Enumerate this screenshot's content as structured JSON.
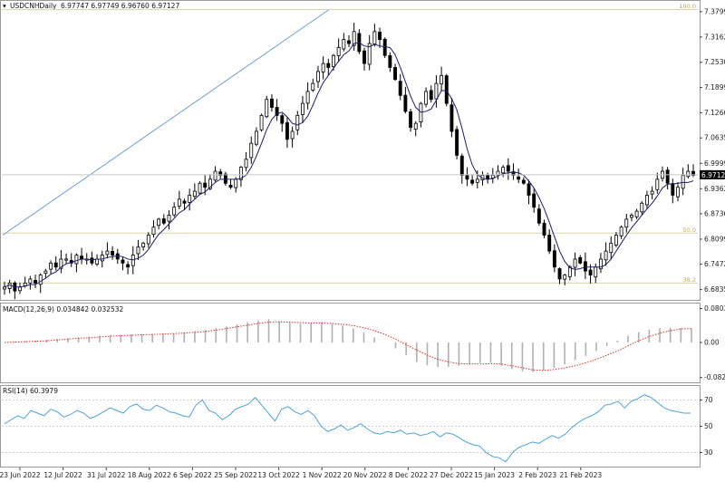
{
  "main_header": {
    "symbol_label": "USDCNHDaily",
    "ohlc_values": "6.97747 6.97749 6.96760 6.97127"
  },
  "macd_header": "MACD(12,26,9) 0.034842 0.032532",
  "rsi_header": "RSI(14) 60.3979",
  "colors": {
    "candle": "#000000",
    "ma_line": "#1c1c6e",
    "trendline": "#6f9fd8",
    "fib_line": "#d8d2a6",
    "macd_hist": "#b0b0b0",
    "macd_signal": "#e0302a",
    "rsi_line": "#4aa3df",
    "current_price_bg": "#000000"
  },
  "chart_data": [
    {
      "type": "candlestick",
      "pane": "price",
      "ylim": [
        6.66,
        7.4
      ],
      "yticks": [
        6.68355,
        6.7472,
        6.8099,
        6.87365,
        6.93625,
        6.9999,
        7.06355,
        7.12665,
        7.1899,
        7.25305,
        7.31625,
        7.3799
      ],
      "ytick_labels": [
        "6.68355",
        "6.74720",
        "6.80990",
        "6.87365",
        "6.93625",
        "6.99990",
        "7.06355",
        "7.12665",
        "7.18990",
        "7.25305",
        "7.31625",
        "7.37990"
      ],
      "current_price": 6.97127,
      "current_price_label": "6.97127",
      "fib_levels": [
        {
          "label": "100.0",
          "value": 7.385
        },
        {
          "label": "50.0",
          "value": 6.825
        },
        {
          "label": "38.2",
          "value": 6.7
        }
      ],
      "trendline": {
        "from": [
          "2022-06-23",
          6.82
        ],
        "to": [
          "2022-10-24",
          7.385
        ]
      },
      "x_labels": [
        "23 Jun 2022",
        "12 Jul 2022",
        "31 Jul 2022",
        "18 Aug 2022",
        "6 Sep 2022",
        "25 Sep 2022",
        "13 Oct 2022",
        "1 Nov 2022",
        "20 Nov 2022",
        "8 Dec 2022",
        "27 Dec 2022",
        "15 Jan 2023",
        "2 Feb 2023",
        "21 Feb 2023"
      ],
      "close_series": [
        6.69,
        6.7,
        6.68,
        6.69,
        6.7,
        6.71,
        6.7,
        6.72,
        6.73,
        6.75,
        6.74,
        6.76,
        6.76,
        6.75,
        6.77,
        6.76,
        6.76,
        6.75,
        6.76,
        6.77,
        6.78,
        6.77,
        6.76,
        6.75,
        6.74,
        6.77,
        6.79,
        6.8,
        6.82,
        6.84,
        6.86,
        6.85,
        6.87,
        6.89,
        6.91,
        6.9,
        6.92,
        6.93,
        6.95,
        6.94,
        6.96,
        6.98,
        6.97,
        6.95,
        6.94,
        6.96,
        6.99,
        7.01,
        7.05,
        7.08,
        7.12,
        7.16,
        7.14,
        7.12,
        7.1,
        7.06,
        7.08,
        7.12,
        7.15,
        7.18,
        7.2,
        7.23,
        7.25,
        7.24,
        7.27,
        7.29,
        7.31,
        7.3,
        7.33,
        7.28,
        7.25,
        7.3,
        7.33,
        7.31,
        7.27,
        7.24,
        7.21,
        7.17,
        7.13,
        7.09,
        7.1,
        7.15,
        7.18,
        7.16,
        7.2,
        7.22,
        7.15,
        7.08,
        7.02,
        6.97,
        6.96,
        6.95,
        6.96,
        6.97,
        6.96,
        6.97,
        6.98,
        6.99,
        6.98,
        6.97,
        6.96,
        6.95,
        6.92,
        6.89,
        6.85,
        6.82,
        6.78,
        6.74,
        6.71,
        6.72,
        6.74,
        6.76,
        6.75,
        6.73,
        6.72,
        6.74,
        6.76,
        6.78,
        6.8,
        6.82,
        6.84,
        6.86,
        6.87,
        6.88,
        6.9,
        6.92,
        6.93,
        6.96,
        6.98,
        6.95,
        6.92,
        6.94,
        6.97,
        6.98,
        6.97
      ]
    },
    {
      "type": "bar+line",
      "pane": "macd",
      "ylim": [
        -0.09,
        0.09
      ],
      "yticks": [
        0.080366,
        0,
        -0.08289
      ],
      "ytick_labels": [
        "0.080366",
        "0.00",
        "-0.08289"
      ],
      "series": [
        {
          "name": "MACD",
          "role": "histogram",
          "values": [
            0.0,
            0.002,
            0.003,
            0.004,
            0.006,
            0.008,
            0.01,
            0.012,
            0.014,
            0.016,
            0.017,
            0.018,
            0.019,
            0.02,
            0.02,
            0.021,
            0.022,
            0.024,
            0.027,
            0.03,
            0.034,
            0.038,
            0.043,
            0.048,
            0.052,
            0.055,
            0.05,
            0.046,
            0.044,
            0.045,
            0.046,
            0.044,
            0.04,
            0.033,
            0.024,
            0.012,
            0.0,
            -0.014,
            -0.03,
            -0.046,
            -0.054,
            -0.058,
            -0.058,
            -0.055,
            -0.052,
            -0.048,
            -0.048,
            -0.055,
            -0.063,
            -0.068,
            -0.07,
            -0.066,
            -0.06,
            -0.052,
            -0.042,
            -0.032,
            -0.02,
            -0.008,
            0.004,
            0.016,
            0.024,
            0.03,
            0.034,
            0.035,
            0.034,
            0.033
          ]
        },
        {
          "name": "Signal",
          "role": "line",
          "values": [
            0.0,
            0.001,
            0.002,
            0.003,
            0.004,
            0.006,
            0.008,
            0.01,
            0.011,
            0.013,
            0.015,
            0.016,
            0.017,
            0.018,
            0.019,
            0.02,
            0.021,
            0.022,
            0.024,
            0.026,
            0.029,
            0.033,
            0.037,
            0.041,
            0.045,
            0.048,
            0.049,
            0.048,
            0.047,
            0.046,
            0.046,
            0.045,
            0.043,
            0.04,
            0.035,
            0.028,
            0.019,
            0.008,
            -0.005,
            -0.018,
            -0.03,
            -0.04,
            -0.046,
            -0.05,
            -0.051,
            -0.051,
            -0.05,
            -0.051,
            -0.055,
            -0.06,
            -0.065,
            -0.066,
            -0.064,
            -0.06,
            -0.055,
            -0.048,
            -0.04,
            -0.03,
            -0.02,
            -0.008,
            0.004,
            0.014,
            0.022,
            0.028,
            0.032,
            0.033
          ]
        }
      ]
    },
    {
      "type": "line",
      "pane": "rsi",
      "ylim": [
        20,
        80
      ],
      "yticks": [
        70,
        50,
        30
      ],
      "ytick_labels": [
        "70",
        "50",
        "30"
      ],
      "series": [
        {
          "name": "RSI",
          "values": [
            52,
            55,
            58,
            56,
            62,
            60,
            58,
            63,
            61,
            57,
            59,
            62,
            60,
            56,
            58,
            61,
            64,
            62,
            60,
            65,
            67,
            63,
            62,
            66,
            64,
            61,
            60,
            58,
            57,
            66,
            70,
            62,
            60,
            55,
            58,
            63,
            65,
            67,
            72,
            66,
            60,
            54,
            63,
            65,
            61,
            59,
            62,
            58,
            50,
            46,
            48,
            51,
            47,
            49,
            52,
            48,
            45,
            44,
            46,
            45,
            47,
            44,
            45,
            43,
            44,
            46,
            42,
            45,
            44,
            41,
            38,
            36,
            35,
            30,
            27,
            26,
            23,
            30,
            34,
            36,
            38,
            37,
            40,
            43,
            41,
            44,
            49,
            53,
            56,
            58,
            61,
            66,
            67,
            69,
            64,
            69,
            71,
            74,
            72,
            68,
            64,
            62,
            61,
            60,
            60
          ]
        }
      ]
    }
  ]
}
